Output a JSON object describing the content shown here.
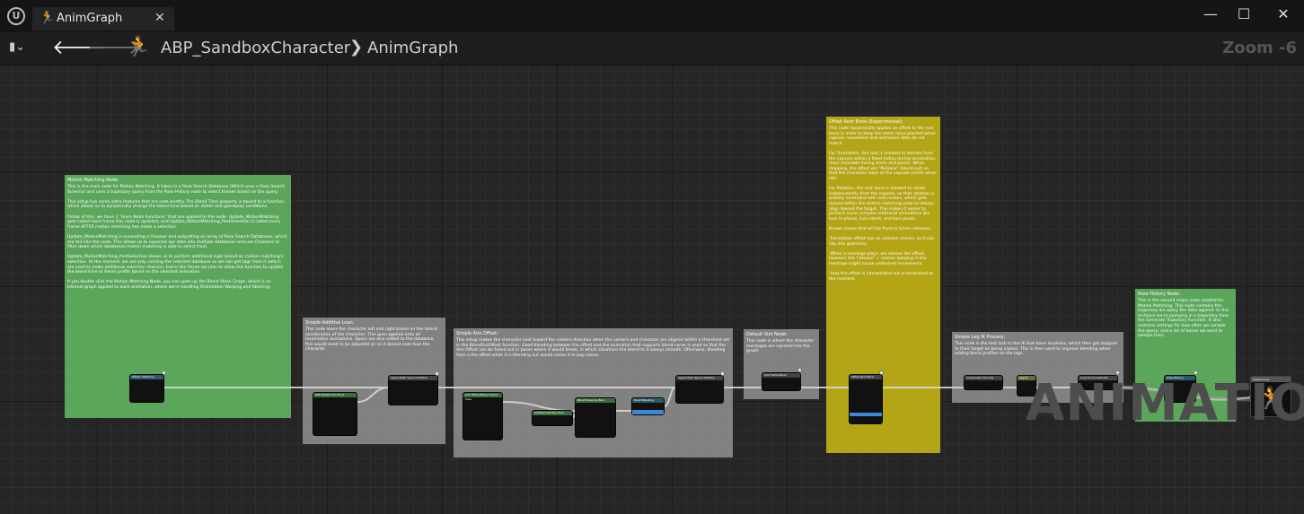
{
  "window": {
    "tab_label": "AnimGraph",
    "tab_icon": "running-man-icon",
    "logo": "U",
    "min_icon": "—",
    "max_icon": "☐",
    "close_icon": "✕",
    "tab_close_icon": "✕"
  },
  "toolbar": {
    "bookmark_icon": "▮⌄",
    "back_icon": "🡐",
    "forward_icon": "🡒",
    "breadcrumb_asset": "ABP_SandboxCharacter",
    "breadcrumb_sep": "❯",
    "breadcrumb_graph": "AnimGraph",
    "zoom": "Zoom -6"
  },
  "watermark": "ANIMATION",
  "comments": {
    "motion_matching": {
      "title": "Motion Matching Node:",
      "body": "This is the main node for Motion Matching. It takes in a Pose Search Database (Which uses a Pose Search Schema) and uses a trajectory query from the Pose History node to select frames based on the query.\n\nThis setup has some extra features that are note worthy. The Blend Time property is bound to a function, which allows us to dynamically change the blend time based on states and gameplay conditions.\n\nOntop of this, we have 2 \"Anim Node Functions\" that are applied to the node. Update_MotionMatching gets called each frame this node is updated, and Update_MotionMatching_PostSelection is called every frame AFTER motion matching has made a selection.\n\nUpdate_MotionMatching is evaluating a Chooser and outputting an array of Pose Search Databases, which are fed into the node. This allows us to separate our data into multiple databases and use Choosers to filter down which databases motion matching is able to select from.\n\nUpdate_MotionMatching_PostSelection allows us to perform additional logic based on motion matching's selection. At the moment, we are only caching the selected database so we can get tags from it (which are used to make additional selection choices), but in the future we plan to allow this function to update the blend time or blend profile based on the selected animation.\n\nIf you double click the Motion Matching Node, you can open up the Blend Stack Graph, which is an internal graph applied to each animation, where we're handling Orientation Warping and Steering."
    },
    "simple_additive": {
      "title": "Simple Additive Lean:",
      "body": "This node leans the character left and right based on the lateral acceleration of the character. This goes applied onto all locomotion animations. Specs are also added to the database, this would need to be adjusted on so it doesnt over-lean the character."
    },
    "simple_aim": {
      "title": "Simple Aim Offset:",
      "body": "This setup makes the character look toward the camera direction when the camera and character are aligned within a threshold set in the BlendOutOffset function. Good blending between the offset and the animation that supports blend curve is used so that the Aim Offset can be faded out in poses where it would break, in which situations the blend to it always smooth. Otherwise, blending from a the offset while it is blending out would cause it to pop issues."
    },
    "default_slot": {
      "title": "Default Slot Node:",
      "body": "This node is where the character montages are injected into the graph."
    },
    "offset_root": {
      "title": "Offset Root Bone (Experimental):",
      "body": "This node dynamically applies an offset to the root bone in order to keep the mesh more planted when capsule movement and animation data do not match.\n\nFor Translation, the root is allowed to deviate from the capsule within a fixed radius during locomotion, most noticable during starts and pivots. When stopping, the offset will \"Release\" (blend out) so that the character stays at the capsule center when idle.\n\nFor Rotation, the root bone is allowed to rotate independently from the capsule, so that rotation is entirely controlled with root motion, which gets moved within the motion matching node to always align toward the target. This makes it easier to perform more complex rotational animations like turn in places, turn starts, and turn pivots.\n\nKnown issues that will be fixed in future releases:\n\n-Translation offset has no collision checks, so it can clip into geometry.\n\n-When a montage plays, we release the offset, however the \"release\" + motion warping in the montage might cause undesired movements.\n\n-How the offset is interpolated out is hardcoded at the moment."
    },
    "simple_leg_ik": {
      "title": "Simple Leg IK Process:",
      "body": "This node is the foot lock to the IK foot bone locations, which then get slapped to their target as being copied. This is then used to improve blending when adding blend profiles on the legs."
    },
    "pose_history": {
      "title": "Pose History Node:",
      "body": "This is the second major node needed for Motion Matching. This node contains the trajectory we query the data against. In this instance we're pumping in a trajectory from the Generate Trajectory Function. It also contains settings for how often we sample the query, and a list of bones we want to sample from."
    }
  },
  "nodes": {
    "motion_matching": "Motion Matching",
    "mm_pose_snapshot": "MM Update Functions",
    "apply_additive": "Apply Mesh Space Additive",
    "mm_offset": "MM Additive Lean Pose",
    "aim_offset": "Aim Offset Player Space Pose",
    "additive_identity": "Additive Identity Pose",
    "blend_poses_by_bool": "Blend Poses by Bool",
    "dead_blending": "Dead Blending",
    "apply_mesh_space_additive_2": "Apply Mesh Space Additive",
    "slot_default": "Slot 'DefaultSlot'",
    "offset_root_bone": "Offset Root Bone",
    "leg_ik_component": "Component To Local",
    "leg_ik": "Leg IK",
    "local_to_component": "Local To Component",
    "pose_history": "Pose History",
    "output_pose": "Output Pose"
  }
}
